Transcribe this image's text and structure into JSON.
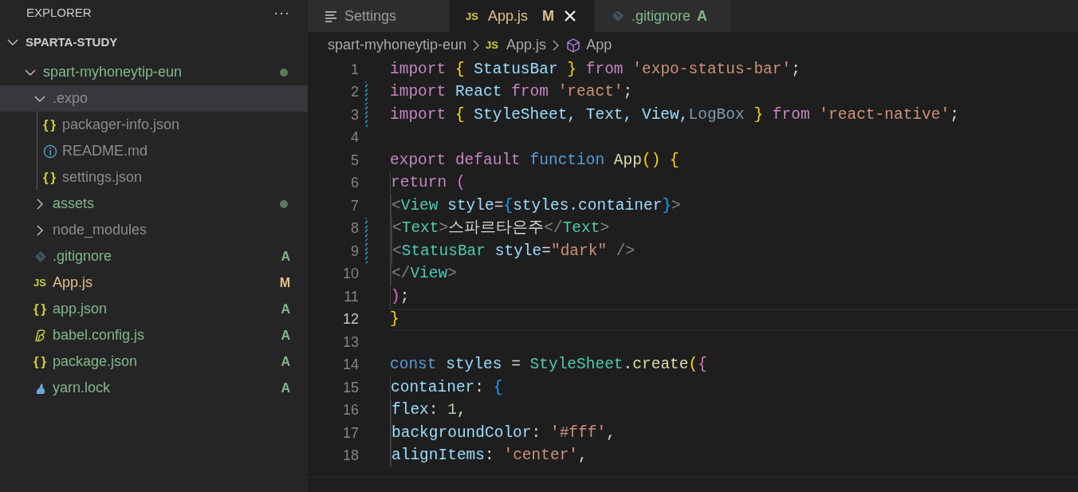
{
  "sidebar": {
    "title": "EXPLORER",
    "more": "···",
    "root": {
      "label": "SPARTA-STUDY",
      "expanded": true,
      "children": [
        {
          "kind": "folder",
          "label": "spart-myhoneytip-eun",
          "expanded": true,
          "selected": false,
          "color": "#81b88b",
          "dot": true,
          "children": [
            {
              "kind": "folder",
              "label": ".expo",
              "expanded": true,
              "selected": true,
              "color": "#8c8c8c",
              "dot": false,
              "children": [
                {
                  "kind": "json",
                  "icon_text": "{}",
                  "label": "packager-info.json",
                  "selected": false,
                  "color": "#8c8c8c"
                },
                {
                  "kind": "info",
                  "label": "README.md",
                  "selected": false,
                  "color": "#8c8c8c"
                },
                {
                  "kind": "json",
                  "icon_text": "{}",
                  "label": "settings.json",
                  "selected": false,
                  "color": "#8c8c8c"
                }
              ]
            },
            {
              "kind": "folder",
              "label": "assets",
              "expanded": false,
              "selected": false,
              "color": "#81b88b",
              "dot": true
            },
            {
              "kind": "folder",
              "label": "node_modules",
              "expanded": false,
              "selected": false,
              "color": "#8c8c8c",
              "dot": false
            },
            {
              "kind": "git",
              "label": ".gitignore",
              "selected": false,
              "color": "#81b88b",
              "badge": "A"
            },
            {
              "kind": "js",
              "icon_text": "JS",
              "label": "App.js",
              "selected": false,
              "color": "#e2c08d",
              "badge": "M"
            },
            {
              "kind": "json",
              "icon_text": "{}",
              "label": "app.json",
              "selected": false,
              "color": "#81b88b",
              "badge": "A"
            },
            {
              "kind": "babel",
              "label": "babel.config.js",
              "selected": false,
              "color": "#81b88b",
              "badge": "A"
            },
            {
              "kind": "json",
              "icon_text": "{}",
              "label": "package.json",
              "selected": false,
              "color": "#81b88b",
              "badge": "A"
            },
            {
              "kind": "yarn",
              "label": "yarn.lock",
              "selected": false,
              "color": "#81b88b",
              "badge": "A"
            }
          ]
        }
      ]
    }
  },
  "tabs": [
    {
      "kind": "settings",
      "label": "Settings",
      "selected": false,
      "color": "#9d9d9d"
    },
    {
      "kind": "js",
      "icon_text": "JS",
      "label": "App.js",
      "selected": true,
      "color": "#e2c08d",
      "badge": "M"
    },
    {
      "kind": "git",
      "label": ".gitignore",
      "selected": false,
      "color": "#81b88b",
      "badge": "A"
    }
  ],
  "breadcrumb": [
    {
      "kind": "folder",
      "label": "spart-myhoneytip-eun"
    },
    {
      "kind": "js",
      "icon_text": "JS",
      "label": "App.js"
    },
    {
      "kind": "symbol",
      "label": "App"
    }
  ],
  "editor": {
    "lines": [
      {
        "number": "1",
        "current": false,
        "modified": false,
        "tokens": [
          {
            "kind": "keyword",
            "text": "import "
          },
          {
            "kind": "brace1",
            "text": "{"
          },
          {
            "kind": "var",
            "text": " StatusBar "
          },
          {
            "kind": "brace1",
            "text": "}"
          },
          {
            "kind": "keyword",
            "text": " from "
          },
          {
            "kind": "string",
            "text": "'expo-status-bar'"
          },
          {
            "kind": "plain",
            "text": ";"
          }
        ]
      },
      {
        "number": "2",
        "current": false,
        "modified": true,
        "tokens": [
          {
            "kind": "keyword",
            "text": "import"
          },
          {
            "kind": "var",
            "text": " React "
          },
          {
            "kind": "keyword",
            "text": "from "
          },
          {
            "kind": "string",
            "text": "'react'"
          },
          {
            "kind": "plain",
            "text": ";"
          }
        ]
      },
      {
        "number": "3",
        "current": false,
        "modified": true,
        "tokens": [
          {
            "kind": "keyword",
            "text": "import "
          },
          {
            "kind": "brace1",
            "text": "{"
          },
          {
            "kind": "var",
            "text": " StyleSheet, Text, View,"
          },
          {
            "kind": "unused",
            "text": "LogBox "
          },
          {
            "kind": "brace1",
            "text": "}"
          },
          {
            "kind": "keyword",
            "text": " from "
          },
          {
            "kind": "string",
            "text": "'react-native'"
          },
          {
            "kind": "plain",
            "text": ";"
          }
        ]
      },
      {
        "number": "4",
        "current": false,
        "modified": false
      },
      {
        "number": "5",
        "current": false,
        "modified": false,
        "tokens": [
          {
            "kind": "keyword",
            "text": "export default "
          },
          {
            "kind": "storage",
            "text": "function "
          },
          {
            "kind": "func",
            "text": "App"
          },
          {
            "kind": "brace1",
            "text": "() {"
          }
        ]
      },
      {
        "number": "6",
        "current": false,
        "modified": false,
        "tokens": [
          {
            "kind": "keyword",
            "text": "  return "
          },
          {
            "kind": "brace2",
            "text": "("
          }
        ]
      },
      {
        "number": "7",
        "current": false,
        "modified": false,
        "tokens": [
          {
            "kind": "tagpunct",
            "text": "    <"
          },
          {
            "kind": "tag",
            "text": "View"
          },
          {
            "kind": "var",
            "text": " style"
          },
          {
            "kind": "plain",
            "text": "="
          },
          {
            "kind": "brace3",
            "text": "{"
          },
          {
            "kind": "var",
            "text": "styles.container"
          },
          {
            "kind": "brace3",
            "text": "}"
          },
          {
            "kind": "tagpunct",
            "text": ">"
          }
        ]
      },
      {
        "number": "8",
        "current": false,
        "modified": true,
        "tokens": [
          {
            "kind": "tagpunct",
            "text": "      <"
          },
          {
            "kind": "tag",
            "text": "Text"
          },
          {
            "kind": "tagpunct",
            "text": ">"
          },
          {
            "kind": "plain",
            "text": "스파르타은주"
          },
          {
            "kind": "tagpunct",
            "text": "</"
          },
          {
            "kind": "tag",
            "text": "Text"
          },
          {
            "kind": "tagpunct",
            "text": ">"
          }
        ]
      },
      {
        "number": "9",
        "current": false,
        "modified": true,
        "tokens": [
          {
            "kind": "tagpunct",
            "text": "      <"
          },
          {
            "kind": "tag",
            "text": "StatusBar"
          },
          {
            "kind": "var",
            "text": " style"
          },
          {
            "kind": "plain",
            "text": "="
          },
          {
            "kind": "string",
            "text": "\"dark\""
          },
          {
            "kind": "tagpunct",
            "text": " />"
          }
        ]
      },
      {
        "number": "10",
        "current": false,
        "modified": false,
        "tokens": [
          {
            "kind": "tagpunct",
            "text": "    </"
          },
          {
            "kind": "tag",
            "text": "View"
          },
          {
            "kind": "tagpunct",
            "text": ">"
          }
        ]
      },
      {
        "number": "11",
        "current": false,
        "modified": false,
        "tokens": [
          {
            "kind": "brace2",
            "text": "  )"
          },
          {
            "kind": "plain",
            "text": ";"
          }
        ]
      },
      {
        "number": "12",
        "current": true,
        "modified": false,
        "tokens": [
          {
            "kind": "brace1",
            "text": "}"
          }
        ]
      },
      {
        "number": "13",
        "current": false,
        "modified": false
      },
      {
        "number": "14",
        "current": false,
        "modified": false,
        "tokens": [
          {
            "kind": "storage",
            "text": "const"
          },
          {
            "kind": "var",
            "text": " styles"
          },
          {
            "kind": "plain",
            "text": " = "
          },
          {
            "kind": "tag",
            "text": "StyleSheet"
          },
          {
            "kind": "plain",
            "text": "."
          },
          {
            "kind": "func",
            "text": "create"
          },
          {
            "kind": "brace1",
            "text": "("
          },
          {
            "kind": "brace2",
            "text": "{"
          }
        ]
      },
      {
        "number": "15",
        "current": false,
        "modified": false,
        "tokens": [
          {
            "kind": "var",
            "text": "  container"
          },
          {
            "kind": "plain",
            "text": ": "
          },
          {
            "kind": "brace3",
            "text": "{"
          }
        ]
      },
      {
        "number": "16",
        "current": false,
        "modified": false,
        "tokens": [
          {
            "kind": "var",
            "text": "    flex"
          },
          {
            "kind": "plain",
            "text": ": "
          },
          {
            "kind": "number",
            "text": "1"
          },
          {
            "kind": "plain",
            "text": ","
          }
        ]
      },
      {
        "number": "17",
        "current": false,
        "modified": false,
        "tokens": [
          {
            "kind": "var",
            "text": "    backgroundColor"
          },
          {
            "kind": "plain",
            "text": ": "
          },
          {
            "kind": "string",
            "text": "'#fff'"
          },
          {
            "kind": "plain",
            "text": ","
          }
        ]
      },
      {
        "number": "18",
        "current": false,
        "modified": false,
        "tokens": [
          {
            "kind": "var",
            "text": "    alignItems"
          },
          {
            "kind": "plain",
            "text": ": "
          },
          {
            "kind": "string",
            "text": "'center'"
          },
          {
            "kind": "plain",
            "text": ","
          }
        ]
      }
    ]
  }
}
